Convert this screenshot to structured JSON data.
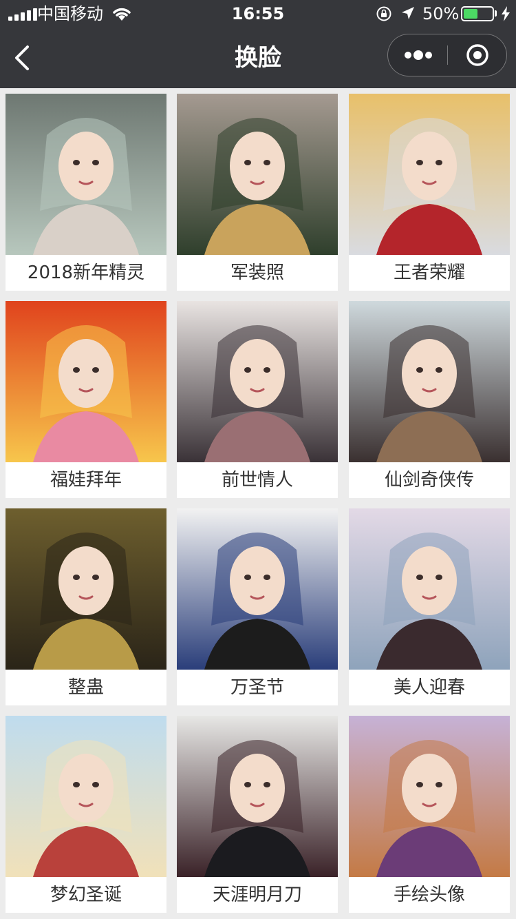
{
  "status_bar": {
    "carrier": "中国移动",
    "time": "16:55",
    "battery_percent": "50%",
    "battery_level": 0.5,
    "battery_color": "#4cd964"
  },
  "nav": {
    "title": "换脸",
    "back_icon": "chevron-left-icon",
    "more_icon": "more-dots-icon",
    "close_icon": "target-circle-icon"
  },
  "colors": {
    "nav_background": "#36373b",
    "page_background": "#ececec",
    "card_background": "#ffffff",
    "label_text": "#333333"
  },
  "templates": [
    {
      "label": "2018新年精灵",
      "palette": [
        "#6e7872",
        "#b7c7bd",
        "#d9d0c8"
      ]
    },
    {
      "label": "军装照",
      "palette": [
        "#a59a91",
        "#2f3f2c",
        "#c9a35c"
      ]
    },
    {
      "label": "王者荣耀",
      "palette": [
        "#e8c06a",
        "#d9dbe0",
        "#b4252b"
      ]
    },
    {
      "label": "福娃拜年",
      "palette": [
        "#e0431d",
        "#f7c64c",
        "#e98aa2"
      ]
    },
    {
      "label": "前世情人",
      "palette": [
        "#e9e4e2",
        "#3a3237",
        "#9a6f73"
      ]
    },
    {
      "label": "仙剑奇侠传",
      "palette": [
        "#cfd9dd",
        "#3a3030",
        "#8d6e54"
      ]
    },
    {
      "label": "整蛊",
      "palette": [
        "#6e5f2e",
        "#2a2418",
        "#b89b48"
      ]
    },
    {
      "label": "万圣节",
      "palette": [
        "#f2f2f2",
        "#2a3e7a",
        "#1c1c1c"
      ]
    },
    {
      "label": "美人迎春",
      "palette": [
        "#e3d9e6",
        "#8ea3bb",
        "#3a2a2e"
      ]
    },
    {
      "label": "梦幻圣诞",
      "palette": [
        "#bfdcee",
        "#f1e1b9",
        "#b9413b"
      ]
    },
    {
      "label": "天涯明月刀",
      "palette": [
        "#e7e7e5",
        "#3a2228",
        "#1b1b1f"
      ]
    },
    {
      "label": "手绘头像",
      "palette": [
        "#c6b2d6",
        "#c47a45",
        "#6b3c77"
      ]
    }
  ]
}
